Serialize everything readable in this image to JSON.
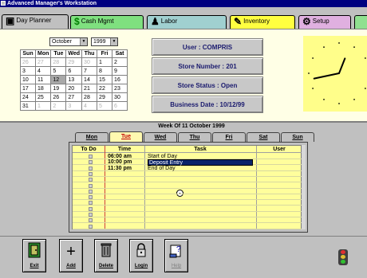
{
  "window": {
    "title": "Advanced Manager's Workstation"
  },
  "tabs": [
    {
      "label": "Day Planner",
      "icon": "computer-icon",
      "color": "#c0c0c0"
    },
    {
      "label": "Cash Mgmt",
      "icon": "dollar-icon",
      "color": "#7fe07f"
    },
    {
      "label": "Labor",
      "icon": "person-icon",
      "color": "#a0d0d0"
    },
    {
      "label": "Inventory",
      "icon": "inventory-icon",
      "color": "#ffff40"
    },
    {
      "label": "Setup",
      "icon": "setup-icon",
      "color": "#e0b0e0"
    },
    {
      "label": "",
      "icon": "",
      "color": "#90e090"
    }
  ],
  "calendar": {
    "month": "October",
    "year": "1999",
    "weekdays": [
      "Sun",
      "Mon",
      "Tue",
      "Wed",
      "Thu",
      "Fri",
      "Sat"
    ],
    "weeks": [
      [
        [
          "26",
          true
        ],
        [
          "27",
          true
        ],
        [
          "28",
          true
        ],
        [
          "29",
          true
        ],
        [
          "30",
          true
        ],
        [
          "1",
          false
        ],
        [
          "2",
          false
        ]
      ],
      [
        [
          "3",
          false
        ],
        [
          "4",
          false
        ],
        [
          "5",
          false
        ],
        [
          "6",
          false
        ],
        [
          "7",
          false
        ],
        [
          "8",
          false
        ],
        [
          "9",
          false
        ]
      ],
      [
        [
          "10",
          false
        ],
        [
          "11",
          false
        ],
        [
          "12",
          false
        ],
        [
          "13",
          false
        ],
        [
          "14",
          false
        ],
        [
          "15",
          false
        ],
        [
          "16",
          false
        ]
      ],
      [
        [
          "17",
          false
        ],
        [
          "18",
          false
        ],
        [
          "19",
          false
        ],
        [
          "20",
          false
        ],
        [
          "21",
          false
        ],
        [
          "22",
          false
        ],
        [
          "23",
          false
        ]
      ],
      [
        [
          "24",
          false
        ],
        [
          "25",
          false
        ],
        [
          "26",
          false
        ],
        [
          "27",
          false
        ],
        [
          "28",
          false
        ],
        [
          "29",
          false
        ],
        [
          "30",
          false
        ]
      ],
      [
        [
          "31",
          false
        ],
        [
          "1",
          true
        ],
        [
          "2",
          true
        ],
        [
          "3",
          true
        ],
        [
          "4",
          true
        ],
        [
          "5",
          true
        ],
        [
          "6",
          true
        ]
      ]
    ],
    "selected": "12"
  },
  "status": {
    "user": "User : COMPRIS",
    "store_number": "Store Number : 201",
    "store_status": "Store Status : Open",
    "business_date": "Business Date : 10/12/99"
  },
  "planner": {
    "week_title": "Week Of 11 October 1999",
    "days": [
      "Mon",
      "Tue",
      "Wed",
      "Thu",
      "Fri",
      "Sat",
      "Sun"
    ],
    "active_day": "Tue",
    "columns": [
      "To Do",
      "Time",
      "Task",
      "User"
    ],
    "entries": [
      {
        "time": "06:00 am",
        "task": "Start of Day",
        "selected": false
      },
      {
        "time": "10:00 pm",
        "task": "Deposit Entry",
        "selected": true
      },
      {
        "time": "11:30 pm",
        "task": "End of Day",
        "selected": false
      }
    ],
    "row_count": 13
  },
  "toolbar": {
    "buttons": [
      {
        "label": "Exit",
        "icon": "exit-door-icon",
        "enabled": true
      },
      {
        "label": "Add",
        "icon": "plus-icon",
        "enabled": true
      },
      {
        "label": "Delete",
        "icon": "trash-icon",
        "enabled": true
      },
      {
        "label": "Login",
        "icon": "lock-icon",
        "enabled": true
      },
      {
        "label": "Help",
        "icon": "help-icon",
        "enabled": false
      }
    ]
  },
  "colors": {
    "title_bar": "#000080",
    "panel_bg": "#ffffe6",
    "grid_bg": "#fffe9c",
    "clock_bg": "#fffe8a",
    "selection": "#0a246a",
    "active_day": "#c00000"
  },
  "clock": {
    "time": "12:43"
  }
}
